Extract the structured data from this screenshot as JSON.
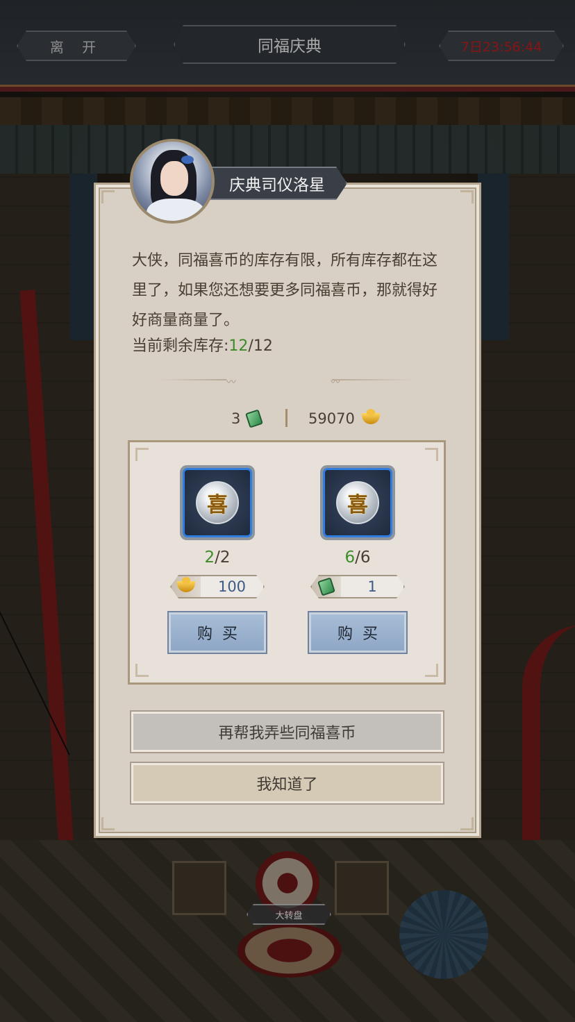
{
  "topbar": {
    "leave_label": "离 开",
    "title": "同福庆典",
    "timer": "7日23:56:44"
  },
  "npc": {
    "name": "庆典司仪洛星",
    "avatar_icon": "npc-portrait-icon"
  },
  "dialog": {
    "message": "大侠，同福喜币的库存有限，所有库存都在这里了，如果您还想要更多同福喜币，那就得好好商量商量了。",
    "stock_label": "当前剩余库存:",
    "stock_current": "12",
    "stock_total": "/12"
  },
  "currency": {
    "jade": {
      "amount": "3",
      "icon": "jade-token-icon"
    },
    "gold": {
      "amount": "59070",
      "icon": "gold-ingot-icon"
    }
  },
  "shop_items": [
    {
      "icon": "xi-coin-icon",
      "coin_glyph": "喜",
      "count_current": "2",
      "count_total": "/2",
      "price": "100",
      "price_icon": "gold-ingot-icon",
      "buy_label": "购买"
    },
    {
      "icon": "xi-coin-icon",
      "coin_glyph": "喜",
      "count_current": "6",
      "count_total": "/6",
      "price": "1",
      "price_icon": "jade-token-icon",
      "buy_label": "购买"
    }
  ],
  "buttons": {
    "more_coins": "再帮我弄些同福喜币",
    "acknowledge": "我知道了"
  },
  "background": {
    "wheel_label": "大转盘"
  },
  "colors": {
    "accent_green": "#3e8b2a",
    "timer_red": "#8a1414",
    "slot_border_blue": "#2f7de0",
    "buy_button_blue": "#8ea7c6"
  }
}
